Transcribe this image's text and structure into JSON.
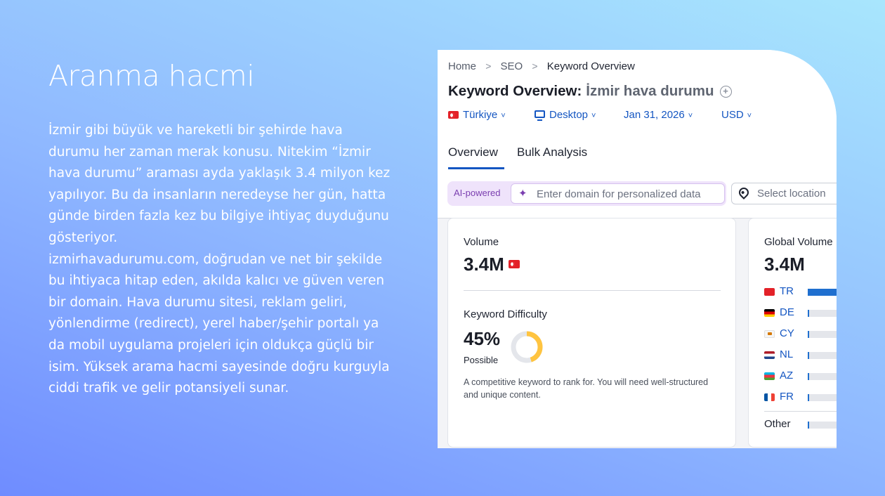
{
  "slide": {
    "title": "Aranma hacmi",
    "paragraph1": "İzmir gibi büyük ve hareketli bir şehirde hava durumu her zaman merak konusu. Nitekim “İzmir hava durumu” araması ayda yaklaşık 3.4 milyon kez yapılıyor. Bu da insanların neredeyse her gün, hatta günde birden fazla kez bu bilgiye ihtiyaç duyduğunu gösteriyor.",
    "paragraph2": "izmirhavadurumu.com, doğrudan ve net bir şekilde bu ihtiyaca hitap eden, akılda kalıcı ve güven veren bir domain. Hava durumu sitesi, reklam geliri, yönlendirme (redirect), yerel haber/şehir portalı ya da mobil uygulama projeleri için oldukça güçlü bir isim. Yüksek arama hacmi sayesinde doğru kurguyla ciddi trafik ve gelir potansiyeli sunar."
  },
  "breadcrumb": {
    "home": "Home",
    "sep": ">",
    "seo": "SEO",
    "current": "Keyword Overview"
  },
  "header": {
    "title": "Keyword Overview:",
    "keyword": "İzmir hava durumu"
  },
  "filters": {
    "country": "Türkiye",
    "device": "Desktop",
    "date": "Jan 31, 2026",
    "currency": "USD"
  },
  "tabs": {
    "overview": "Overview",
    "bulk": "Bulk Analysis"
  },
  "ai": {
    "label": "AI-powered",
    "placeholder": "Enter domain for personalized data",
    "location_placeholder": "Select location"
  },
  "volume_card": {
    "label": "Volume",
    "value": "3.4M",
    "kd_label": "Keyword Difficulty",
    "kd_value": "45%",
    "kd_percent": 45,
    "kd_level": "Possible",
    "kd_description": "A competitive keyword to rank for. You will need well-structured and unique content.",
    "kd_color": "#ffc440"
  },
  "global_card": {
    "label": "Global Volume",
    "value": "3.4M",
    "countries": [
      {
        "code": "TR",
        "share": 95
      },
      {
        "code": "DE",
        "share": 2
      },
      {
        "code": "CY",
        "share": 2
      },
      {
        "code": "NL",
        "share": 2
      },
      {
        "code": "AZ",
        "share": 2
      },
      {
        "code": "FR",
        "share": 2
      }
    ],
    "other_label": "Other",
    "other_share": 2,
    "bar_color": "#1f6fcf"
  }
}
